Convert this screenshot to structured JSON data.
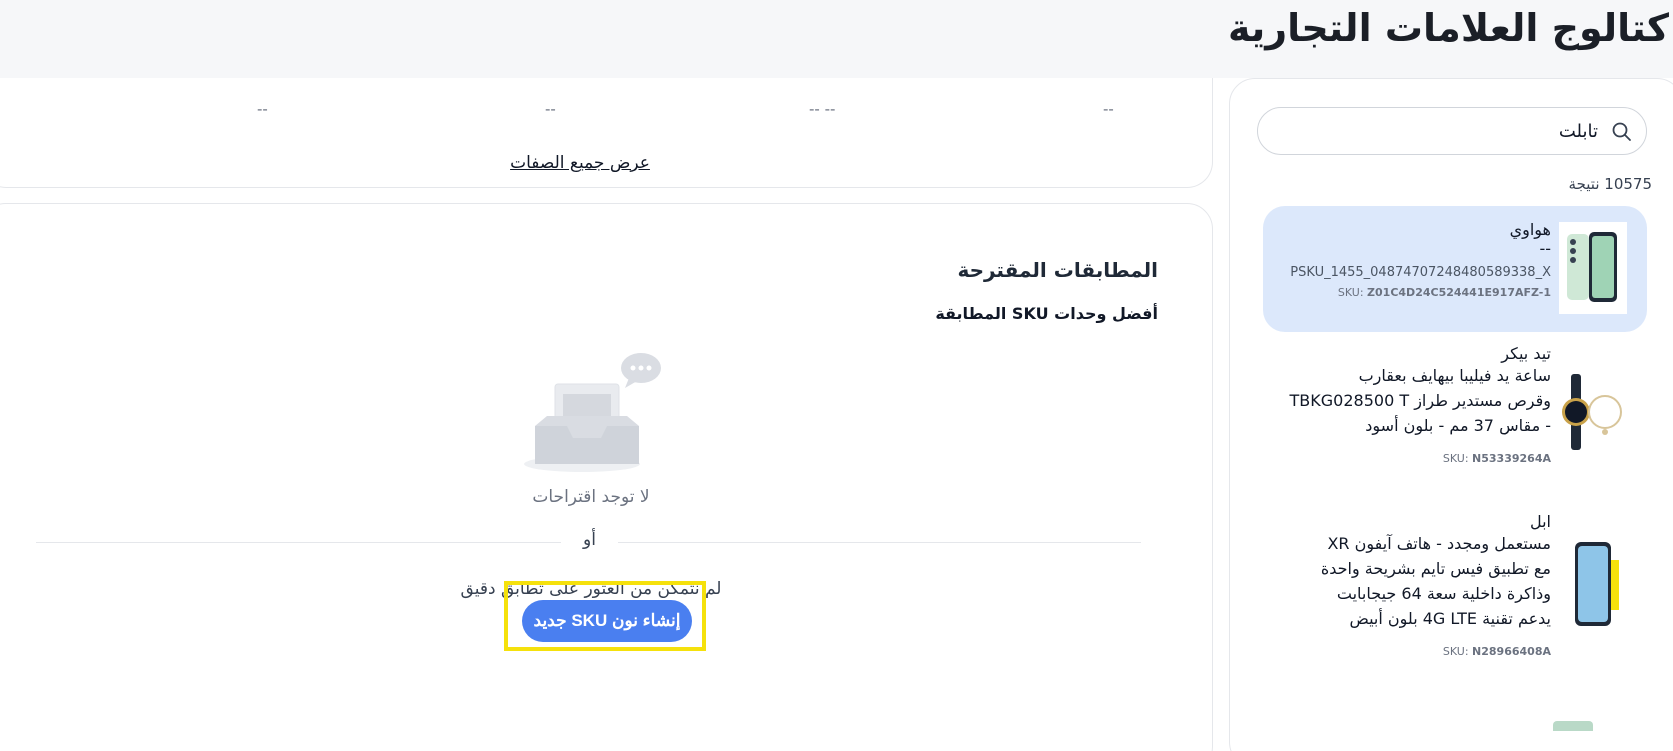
{
  "header": {
    "title": "كتالوج العلامات التجارية"
  },
  "attributes": {
    "dashes": [
      "--",
      "--",
      "-- --",
      "--"
    ],
    "view_all_label": "عرض جميع الصفات"
  },
  "suggestions": {
    "title": "المطابقات المقترحة",
    "subtitle": "أفضل وحدات SKU المطابقة",
    "empty_text": "لا توجد اقتراحات",
    "or_text": "أو",
    "no_match_text": "لم نتمكن من العثور على تطابق دقيق",
    "create_button": "إنشاء نون SKU جديد"
  },
  "search": {
    "value": "تابلت",
    "result_count": "10575 نتيجة"
  },
  "results": [
    {
      "brand": "هواوي",
      "desc": "--",
      "psku": "PSKU_1455_04874707248480589338_X",
      "sku_prefix": "SKU: ",
      "sku": "Z01C4D24C524441E917AFZ-1",
      "selected": true,
      "thumb": "phone-green"
    },
    {
      "brand": "تيد بيكر",
      "desc_lines": [
        "ساعة يد فيليبا بيهايف بعقارب",
        "وقرص مستدير طراز TBKG028500 T",
        "- مقاس 37 مم - بلون أسود"
      ],
      "sku_prefix": "SKU: ",
      "sku": "N53339264A",
      "selected": false,
      "thumb": "watch"
    },
    {
      "brand": "ابل",
      "desc_lines": [
        "مستعمل ومجدد - هاتف آيفون XR",
        "مع تطبيق فيس تايم بشريحة واحدة",
        "وذاكرة داخلية سعة 64 جيجابايت",
        "يدعم تقنية 4G LTE بلون أبيض"
      ],
      "sku_prefix": "SKU: ",
      "sku": "N28966408A",
      "selected": false,
      "thumb": "iphone"
    }
  ],
  "colors": {
    "accent": "#4a7ff0",
    "selected_bg": "#dce8fb",
    "highlight": "#f5e10c"
  }
}
